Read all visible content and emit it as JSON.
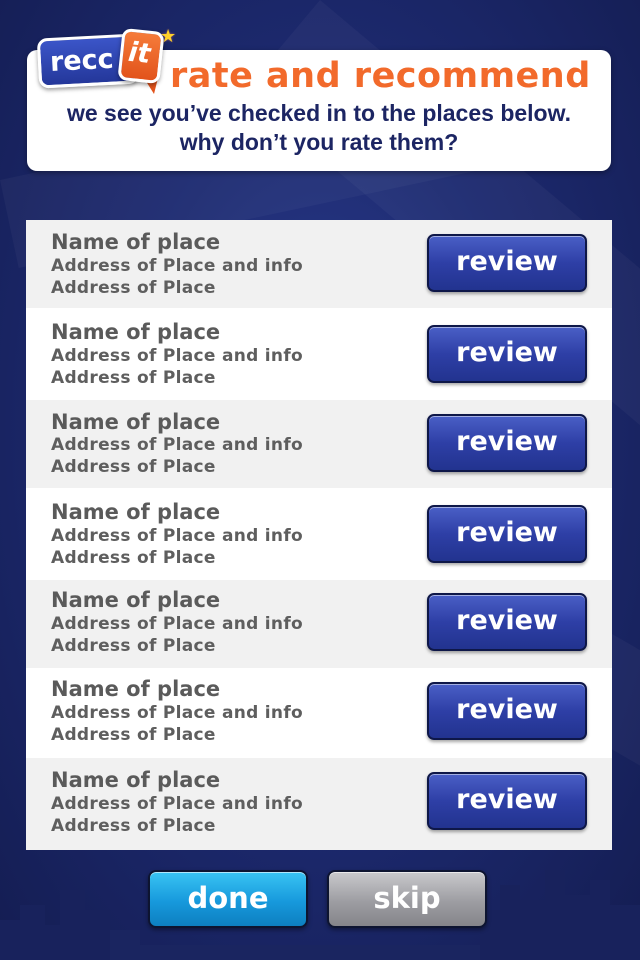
{
  "app": {
    "logo_recc": "recc",
    "logo_it": "it"
  },
  "header": {
    "title": "rate and recommend",
    "subtitle_line1": "we see you’ve checked in to the places below.",
    "subtitle_line2": "why don’t you rate them?"
  },
  "places": [
    {
      "name": "Name of place",
      "address1": "Address of Place and info",
      "address2": "Address of Place",
      "button": "review"
    },
    {
      "name": "Name of place",
      "address1": "Address of Place and info",
      "address2": "Address of Place",
      "button": "review"
    },
    {
      "name": "Name of place",
      "address1": "Address of Place and info",
      "address2": "Address of Place",
      "button": "review"
    },
    {
      "name": "Name of place",
      "address1": "Address of Place and info",
      "address2": "Address of Place",
      "button": "review"
    },
    {
      "name": "Name of place",
      "address1": "Address of Place and info",
      "address2": "Address of Place",
      "button": "review"
    },
    {
      "name": "Name of place",
      "address1": "Address of Place and info",
      "address2": "Address of Place",
      "button": "review"
    },
    {
      "name": "Name of place",
      "address1": "Address of Place and info",
      "address2": "Address of Place",
      "button": "review"
    }
  ],
  "footer": {
    "done_label": "done",
    "skip_label": "skip"
  },
  "colors": {
    "brand_orange": "#f26a2b",
    "brand_navy": "#1c2563",
    "review_blue": "#2e3fa6",
    "done_blue": "#1799dc",
    "skip_gray": "#9d9da2"
  }
}
